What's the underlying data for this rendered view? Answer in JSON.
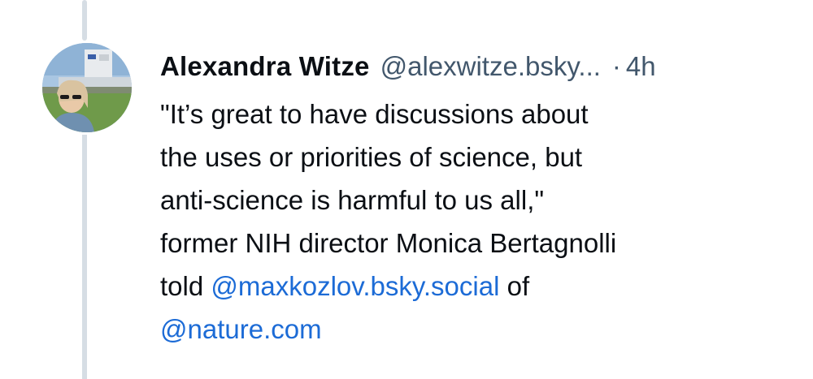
{
  "post": {
    "author_name": "Alexandra Witze",
    "author_handle": "@alexwitze.bsky...",
    "separator": "·",
    "timestamp": "4h",
    "lines": [
      "\"It’s great to have discussions about",
      "the uses or priorities of science, but",
      "anti-science is harmful to us all,\"",
      "former NIH director Monica Bertagnolli"
    ],
    "told_prefix": "told",
    "mention_1": "@maxkozlov.bsky.social",
    "of_suffix": "of",
    "mention_2": "@nature.com"
  },
  "colors": {
    "text": "#0b0f14",
    "muted": "#42576c",
    "link": "#1c6bd6",
    "thread_line": "#d6dde4"
  }
}
